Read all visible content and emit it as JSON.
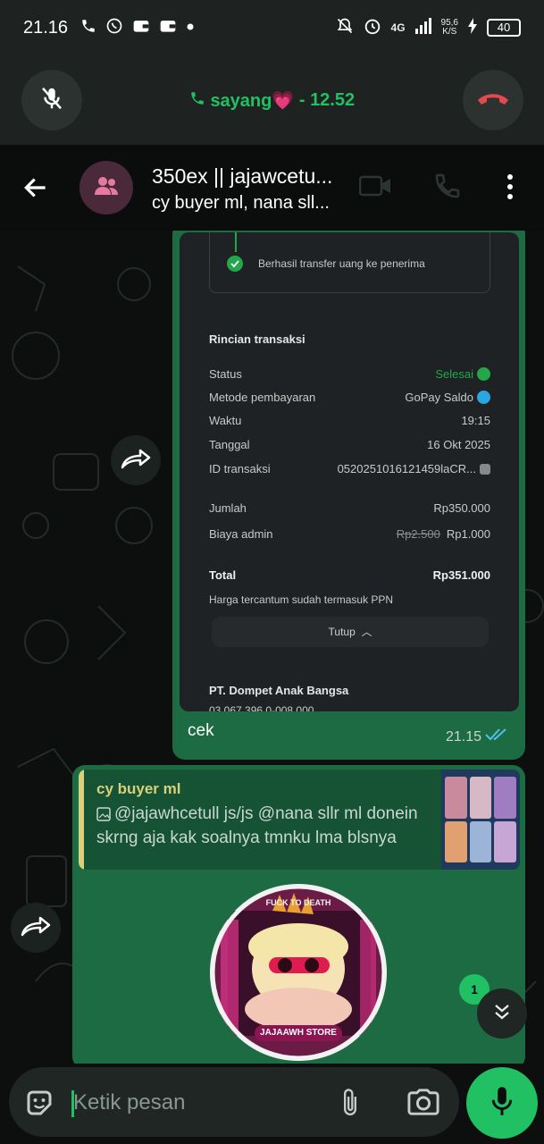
{
  "status_bar": {
    "time": "21.16",
    "network": "4G",
    "net_speed_value": "95,6",
    "net_speed_unit": "K/S",
    "battery": "40"
  },
  "call": {
    "name": "sayang💗",
    "separator": "-",
    "duration": "12.52"
  },
  "header": {
    "title": "350ex || jajawcetu...",
    "subtitle": "cy buyer ml, nana sll..."
  },
  "message1": {
    "screenshot": {
      "success_text": "Berhasil transfer uang ke penerima",
      "section_title": "Rincian transaksi",
      "rows": [
        {
          "label": "Status",
          "value": "Selesai"
        },
        {
          "label": "Metode pembayaran",
          "value": "GoPay Saldo"
        },
        {
          "label": "Waktu",
          "value": "19:15"
        },
        {
          "label": "Tanggal",
          "value": "16 Okt 2025"
        },
        {
          "label": "ID transaksi",
          "value": "0520251016121459laCR..."
        },
        {
          "label": "Jumlah",
          "value": "Rp350.000"
        },
        {
          "label": "Biaya admin",
          "old_value": "Rp2.500",
          "value": "Rp1.000"
        }
      ],
      "total_label": "Total",
      "total_value": "Rp351.000",
      "ppn_note": "Harga tercantum sudah termasuk PPN",
      "collapse_label": "Tutup",
      "company": "PT. Dompet Anak Bangsa",
      "account": "03.067.396.0-008.000"
    },
    "caption": "cek",
    "time": "21.15"
  },
  "message2": {
    "quote_author": "cy buyer ml",
    "quote_text": "@jajawhcetull js/js @nana sllr ml donein skrng aja kak soalnya tmnku lma blsnya",
    "sticker_top_text": "FUCK TO DEATH",
    "sticker_bottom_text": "JAJAAWH STORE"
  },
  "unread_count": "1",
  "input": {
    "placeholder": "Ketik pesan"
  },
  "colors": {
    "accent": "#21c063",
    "bubble": "#1d6b43",
    "end_call": "#e5484d"
  },
  "icons": [
    "phone-icon",
    "whatsapp-icon",
    "wallet-icon",
    "alarm-icon",
    "mic-off-icon",
    "end-call-icon",
    "back-arrow-icon",
    "group-icon",
    "video-icon",
    "menu-icon",
    "forward-icon",
    "double-check-icon",
    "chevron-down-icon",
    "emoji-icon",
    "attach-icon",
    "camera-icon",
    "mic-icon"
  ]
}
